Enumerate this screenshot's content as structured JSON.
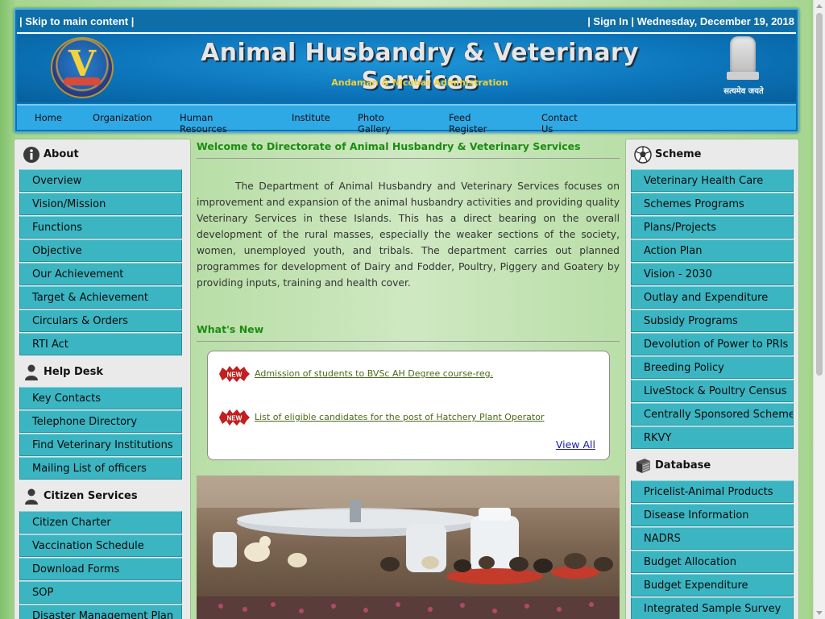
{
  "topbar": {
    "skip_link": "| Skip to main content |",
    "sign_in": "| Sign In |",
    "date": "Wednesday, December 19, 2018"
  },
  "banner": {
    "title": "Animal Husbandry & Veterinary Services",
    "subtitle": "Andaman & Nicobar Administration",
    "emblem_motto": "सत्यमेव जयते",
    "logo_letter": "V"
  },
  "nav": {
    "items": [
      "Home",
      "Organization",
      "Human Resources",
      "Institute",
      "Photo Gallery",
      "Feed Register",
      "Contact Us"
    ]
  },
  "left": {
    "about": {
      "heading": "About",
      "items": [
        "Overview",
        "Vision/Mission",
        "Functions",
        "Objective",
        "Our Achievement",
        "Target & Achievement",
        "Circulars & Orders",
        "RTI Act"
      ]
    },
    "helpdesk": {
      "heading": "Help Desk",
      "items": [
        "Key Contacts",
        "Telephone Directory",
        "Find Veterinary Institutions",
        "Mailing List of officers"
      ]
    },
    "citizen": {
      "heading": "Citizen Services",
      "items": [
        "Citizen Charter",
        "Vaccination Schedule",
        "Download Forms",
        "SOP",
        "Disaster Management Plan"
      ]
    }
  },
  "right": {
    "scheme": {
      "heading": "Scheme",
      "items": [
        "Veterinary Health Care",
        "Schemes Programs",
        "Plans/Projects",
        "Action Plan",
        "Vision - 2030",
        "Outlay and Expenditure",
        "Subsidy Programs",
        "Devolution of Power to PRIs",
        "Breeding Policy",
        "LiveStock & Poultry Census",
        "Centrally Sponsored Schemes",
        "RKVY"
      ]
    },
    "database": {
      "heading": "Database",
      "items": [
        "Pricelist-Animal Products",
        "Disease Information",
        "NADRS",
        "Budget Allocation",
        "Budget Expenditure",
        "Integrated Sample Survey"
      ]
    }
  },
  "main": {
    "welcome": "Welcome to Directorate of Animal Husbandry & Veterinary Services",
    "intro": "The Department of Animal Husbandry and Veterinary Services focuses on improvement and expansion of the animal husbandry activities and providing quality Veterinary Services in these Islands. This has a direct bearing on the overall development of the rural masses, especially the weaker sections of the society, women, unemployed youth, and tribals. The department carries out planned programmes for development of Dairy and Fodder, Poultry, Piggery and Goatery by providing inputs, training and health cover.",
    "whats_new_title": "What's New",
    "news": [
      {
        "badge": "NEW",
        "text": "Admission of students to BVSc AH Degree course-reg."
      },
      {
        "badge": "NEW",
        "text": "List of eligible candidates for the post of Hatchery Plant Operator"
      }
    ],
    "view_all": "View All"
  },
  "colors": {
    "header_blue": "#0a73b5",
    "nav_blue": "#2fa8e6",
    "menu_teal": "#3bb5c2",
    "heading_green": "#1b8c12",
    "title_gold": "#f2d13b"
  }
}
